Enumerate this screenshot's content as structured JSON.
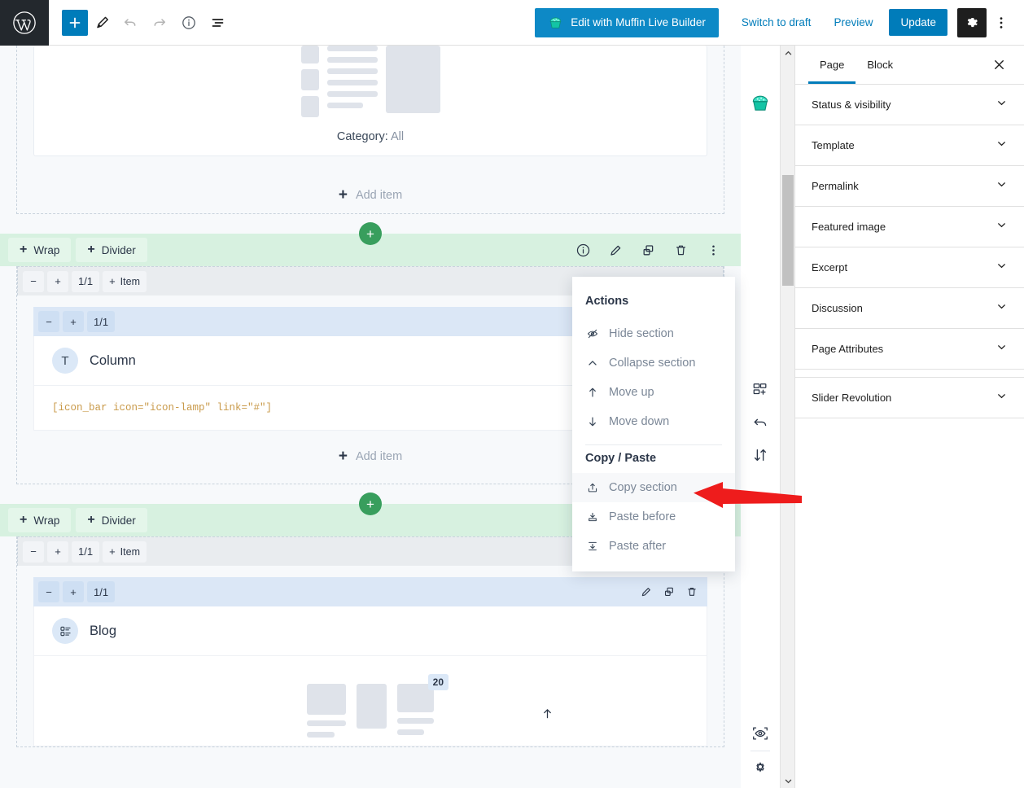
{
  "adminbar": {
    "wp_logo_icon": "wordpress-logo-icon",
    "tools": [
      {
        "name": "add-block-button",
        "icon": "plus-icon",
        "label": "+"
      },
      {
        "name": "edit-mode-button",
        "icon": "pencil-icon",
        "label": ""
      },
      {
        "name": "undo-button",
        "icon": "undo-arrow-icon",
        "label": ""
      },
      {
        "name": "redo-button",
        "icon": "redo-arrow-icon",
        "label": ""
      },
      {
        "name": "details-button",
        "icon": "info-circle-icon",
        "label": ""
      },
      {
        "name": "list-view-button",
        "icon": "list-view-icon",
        "label": ""
      }
    ],
    "muffin_button": "Edit with Muffin Live Builder",
    "muffin_icon": "muffin-cupcake-icon",
    "switch_to_draft": "Switch to draft",
    "preview": "Preview",
    "update": "Update",
    "settings_icon": "gear-icon",
    "options_icon": "kebab-menu-icon"
  },
  "canvas": {
    "top_section": {
      "category_label": "Category:",
      "category_value": "All",
      "add_item": "Add item",
      "add_item_plus": "+"
    },
    "section_two": {
      "wrap_label": "Wrap",
      "divider_label": "Divider",
      "plus": "+",
      "icons": [
        {
          "name": "section-info-icon",
          "icon": "info-circle-icon"
        },
        {
          "name": "section-edit-icon",
          "icon": "pencil-icon"
        },
        {
          "name": "section-duplicate-icon",
          "icon": "copy-icon"
        },
        {
          "name": "section-delete-icon",
          "icon": "trash-icon"
        },
        {
          "name": "section-more-icon",
          "icon": "kebab-menu-icon"
        }
      ],
      "item_bar": {
        "minus": "−",
        "plus": "+",
        "ratio": "1/1",
        "add_item": "Item"
      },
      "column_bar": {
        "minus": "−",
        "plus": "+",
        "ratio": "1/1"
      },
      "element": {
        "icon_glyph": "T",
        "title": "Column"
      },
      "shortcode": "[icon_bar icon=\"icon-lamp\" link=\"#\"]",
      "add_item": "Add item"
    },
    "section_three": {
      "wrap_label": "Wrap",
      "divider_label": "Divider",
      "plus": "+",
      "item_bar": {
        "minus": "−",
        "plus": "+",
        "ratio": "1/1",
        "add_item": "Item"
      },
      "column_bar": {
        "minus": "−",
        "plus": "+",
        "ratio": "1/1"
      },
      "element": {
        "icon_glyph": "blog-list-icon",
        "title": "Blog"
      },
      "count_badge": "20",
      "bar_icons": [
        {
          "name": "row-edit-icon",
          "icon": "pencil-icon"
        },
        {
          "name": "row-duplicate-icon",
          "icon": "copy-icon"
        },
        {
          "name": "row-delete-icon",
          "icon": "trash-icon"
        }
      ]
    }
  },
  "rail": {
    "items": [
      {
        "name": "muffin-builder-toggle",
        "icon": "muffin-cupcake-icon"
      },
      {
        "name": "add-template-icon",
        "icon": "add-layout-icon"
      },
      {
        "name": "revert-icon",
        "icon": "undo-arrow-icon"
      },
      {
        "name": "reorder-icon",
        "icon": "sort-updown-icon"
      },
      {
        "name": "preview-eye-icon",
        "icon": "eye-focus-icon"
      },
      {
        "name": "builder-settings-icon",
        "icon": "gear-icon"
      }
    ]
  },
  "scrollbar": {
    "up_arrow_icon": "chevron-up-icon",
    "down_arrow_icon": "chevron-down-icon"
  },
  "sidebar": {
    "tabs": [
      {
        "label": "Page",
        "active": true
      },
      {
        "label": "Block",
        "active": false
      }
    ],
    "close_icon": "close-x-icon",
    "panels": [
      {
        "label": "Status & visibility",
        "icon": "chevron-down-icon"
      },
      {
        "label": "Template",
        "icon": "chevron-down-icon"
      },
      {
        "label": "Permalink",
        "icon": "chevron-down-icon"
      },
      {
        "label": "Featured image",
        "icon": "chevron-down-icon"
      },
      {
        "label": "Excerpt",
        "icon": "chevron-down-icon"
      },
      {
        "label": "Discussion",
        "icon": "chevron-down-icon"
      },
      {
        "label": "Page Attributes",
        "icon": "chevron-down-icon"
      },
      {
        "label": "Slider Revolution",
        "icon": "chevron-down-icon"
      }
    ]
  },
  "actions_menu": {
    "heading_actions": "Actions",
    "heading_copy_paste": "Copy / Paste",
    "items": [
      {
        "label": "Hide section",
        "icon": "eye-slash-icon",
        "hover": false
      },
      {
        "label": "Collapse section",
        "icon": "chevron-up-icon",
        "hover": false
      },
      {
        "label": "Move up",
        "icon": "arrow-up-icon",
        "hover": false
      },
      {
        "label": "Move down",
        "icon": "arrow-down-icon",
        "hover": false
      }
    ],
    "copy_items": [
      {
        "label": "Copy section",
        "icon": "copy-upload-icon",
        "hover": true
      },
      {
        "label": "Paste before",
        "icon": "paste-before-icon",
        "hover": false
      },
      {
        "label": "Paste after",
        "icon": "paste-after-icon",
        "hover": false
      }
    ]
  },
  "annotation": {
    "arrow_color": "#ee1c1c",
    "arrow_name": "red-pointer-arrow"
  },
  "colors": {
    "wp_blue": "#007cba",
    "muffin_blue": "#0d89c6",
    "section_green": "#d7f1e0",
    "plus_green": "#389e5d",
    "canvas_bg": "#f7f9fb",
    "code_orange": "#c99a4a"
  }
}
